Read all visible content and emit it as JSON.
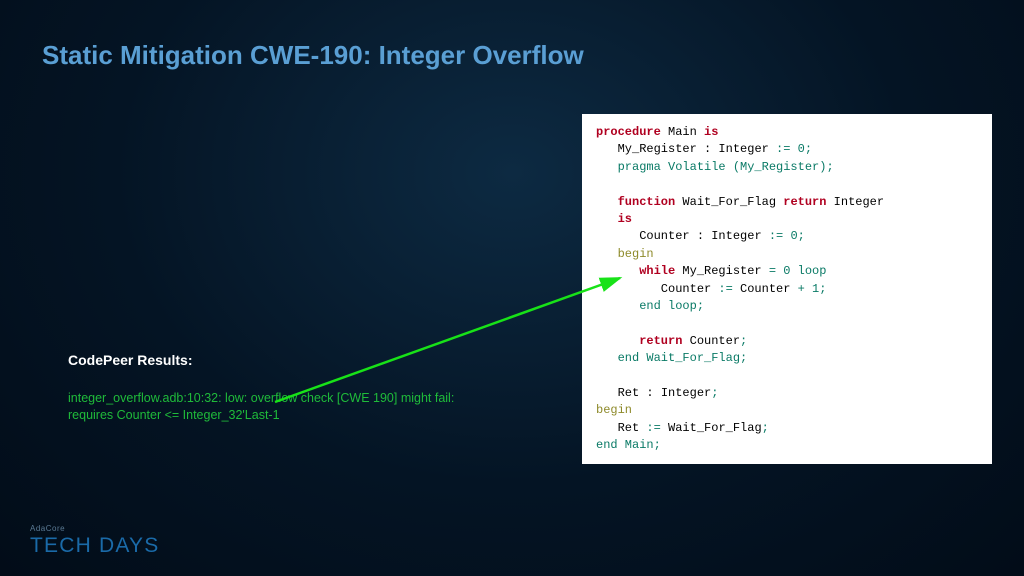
{
  "title": "Static Mitigation CWE-190: Integer Overflow",
  "results": {
    "heading": "CodePeer Results:",
    "line1": "integer_overflow.adb:10:32: low: overflow check [CWE 190] might fail:",
    "line2": "requires Counter <= Integer_32'Last-1"
  },
  "code": {
    "l1_procedure": "procedure",
    "l1_name": " Main ",
    "l1_is": "is",
    "l2_decl": "   My_Register ",
    "l2_colon": ": Integer ",
    "l2_assign": ":= ",
    "l2_zero": "0",
    "l2_semi": ";",
    "l3_pragma": "   pragma Volatile (My_Register);",
    "l5_function": "   function",
    "l5_name": " Wait_For_Flag ",
    "l5_return": "return",
    "l5_type": " Integer",
    "l6_is": "   is",
    "l7_decl": "      Counter ",
    "l7_colon": ": Integer ",
    "l7_assign": ":= ",
    "l7_zero": "0",
    "l7_semi": ";",
    "l8_begin": "   begin",
    "l9_while": "      while",
    "l9_expr": " My_Register ",
    "l9_eq": "= ",
    "l9_zero": "0 ",
    "l9_loop": "loop",
    "l10_lhs": "         Counter ",
    "l10_assign": ":= ",
    "l10_rhs": "Counter ",
    "l10_plus": "+ ",
    "l10_one": "1",
    "l10_semi": ";",
    "l11_endloop": "      end loop;",
    "l13_return": "      return",
    "l13_name": " Counter",
    "l13_semi": ";",
    "l14_end": "   end Wait_For_Flag;",
    "l16_ret": "   Ret ",
    "l16_colon": ": Integer",
    "l16_semi": ";",
    "l17_begin": "begin",
    "l18_lhs": "   Ret ",
    "l18_assign": ":= ",
    "l18_call": "Wait_For_Flag",
    "l18_semi": ";",
    "l19_end": "end Main;"
  },
  "footer": {
    "small": "AdaCore",
    "big": "TECH DAYS"
  }
}
